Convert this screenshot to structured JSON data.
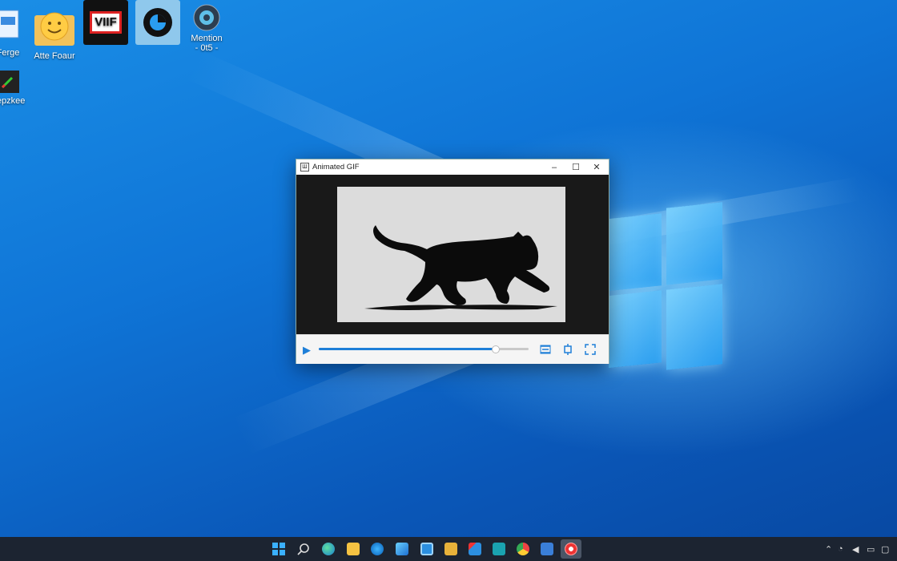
{
  "desktop": {
    "icons": [
      {
        "label": "Ferge",
        "icon": "document-icon"
      },
      {
        "label": "Atte Foaur",
        "icon": "smiley-folder-icon"
      },
      {
        "label": "VIIF",
        "icon": "gif-app-icon"
      },
      {
        "label": "",
        "icon": "media-player-icon"
      },
      {
        "label": "Mention\n- 0t5 -",
        "icon": "settings-gear-icon"
      },
      {
        "label": "Pepzkee",
        "icon": "paint-app-icon"
      }
    ]
  },
  "window": {
    "title": "Animated GIF",
    "app_icon": "gif-icon",
    "minimize": "–",
    "maximize": "☐",
    "close": "✕",
    "playback_progress": 0.84
  },
  "taskbar": {
    "items": [
      "start-icon",
      "search-icon",
      "edge-icon",
      "file-explorer-icon",
      "edge-alt-icon",
      "photos-icon",
      "store-icon",
      "folder-icon",
      "mail-icon",
      "terminal-icon",
      "chrome-icon",
      "paint-icon",
      "gif-viewer-icon"
    ],
    "tray": [
      "chevron-up-icon",
      "wifi-icon",
      "volume-icon",
      "battery-icon",
      "notification-icon"
    ]
  },
  "colors": {
    "accent": "#1e7fd8",
    "taskbar": "#1c2431",
    "desktop": "#0f74d6"
  }
}
